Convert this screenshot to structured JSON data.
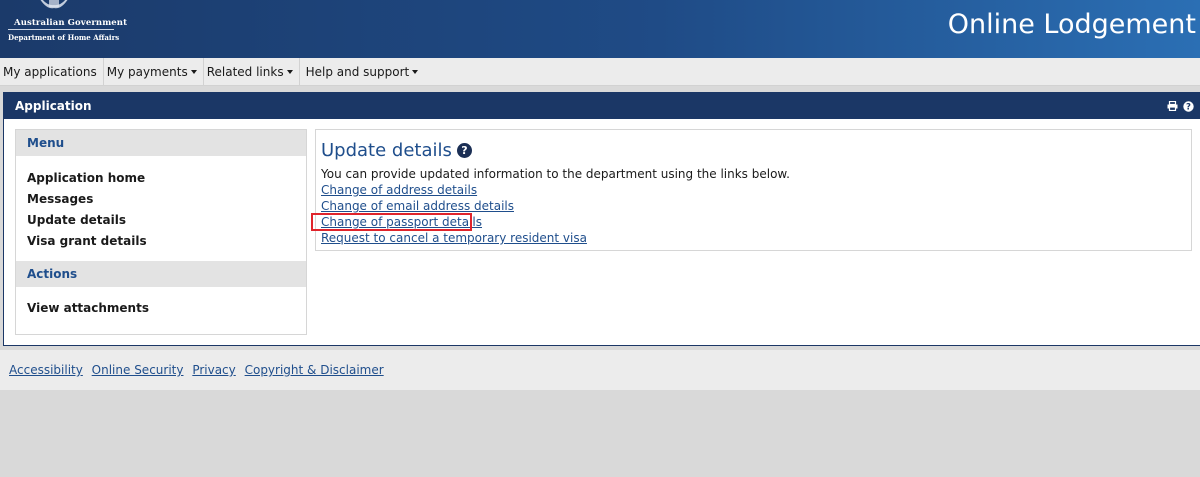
{
  "header": {
    "gov_line1": "Australian Government",
    "gov_line2": "Department of Home Affairs",
    "site_title": "Online Lodgement",
    "crest_icon": "coat-of-arms-icon"
  },
  "nav": {
    "items": [
      {
        "label": "My applications",
        "dropdown": false
      },
      {
        "label": "My payments",
        "dropdown": true
      },
      {
        "label": "Related links",
        "dropdown": true
      },
      {
        "label": "Help and support",
        "dropdown": true
      }
    ]
  },
  "panel": {
    "title": "Application",
    "tool_icons": [
      "print-icon",
      "help-icon"
    ]
  },
  "menu": {
    "heading": "Menu",
    "items": [
      "Application home",
      "Messages",
      "Update details",
      "Visa grant details"
    ],
    "actions_heading": "Actions",
    "actions": [
      "View attachments"
    ]
  },
  "content": {
    "title": "Update details",
    "help_glyph": "?",
    "intro": "You can provide updated information to the department using the links below.",
    "links": [
      "Change of address details",
      "Change of email address details",
      "Change of passport details",
      "Request to cancel a temporary resident visa"
    ],
    "highlighted_link_index": 2
  },
  "footer": {
    "links": [
      "Accessibility",
      "Online Security",
      "Privacy",
      "Copyright & Disclaimer"
    ]
  },
  "colors": {
    "header_dark": "#1b3a6a",
    "header_light": "#2b6fb4",
    "panel_bar": "#1b3766",
    "link": "#1f4e8c",
    "highlight": "#e0242b"
  }
}
